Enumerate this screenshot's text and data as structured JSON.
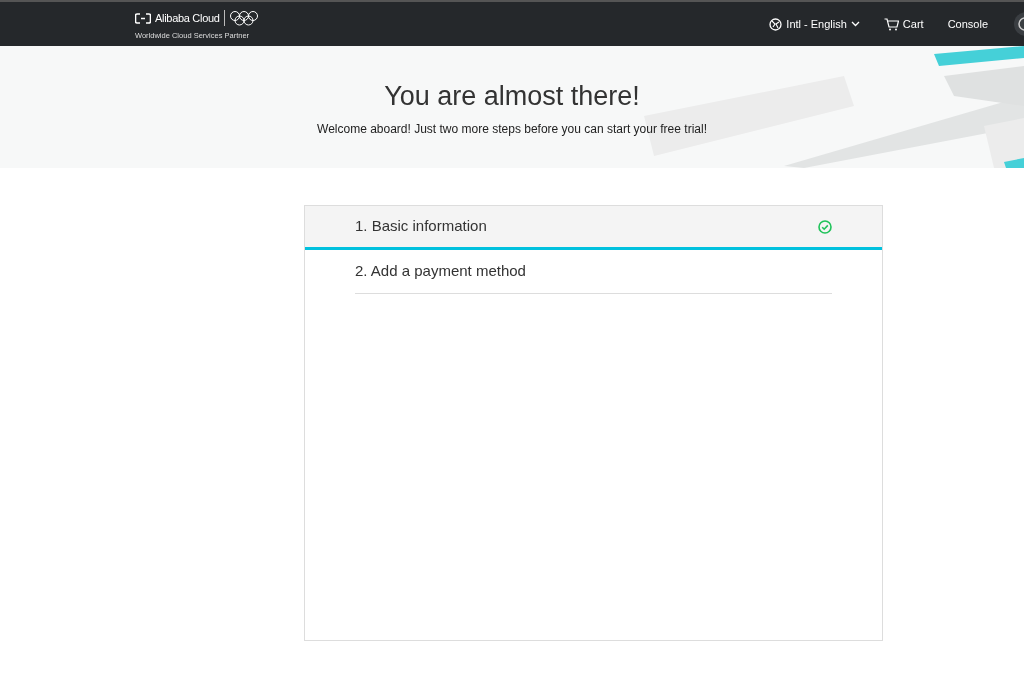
{
  "header": {
    "logo_text": "Alibaba Cloud",
    "tagline": "Worldwide Cloud Services Partner",
    "language": "Intl - English",
    "cart": "Cart",
    "console": "Console"
  },
  "hero": {
    "title": "You are almost there!",
    "subtitle": "Welcome aboard! Just two more steps before you can start your free trial!"
  },
  "steps": [
    {
      "label": "1. Basic information",
      "selected": true,
      "completed": true
    },
    {
      "label": "2. Add a payment method",
      "selected": false,
      "completed": false
    }
  ]
}
